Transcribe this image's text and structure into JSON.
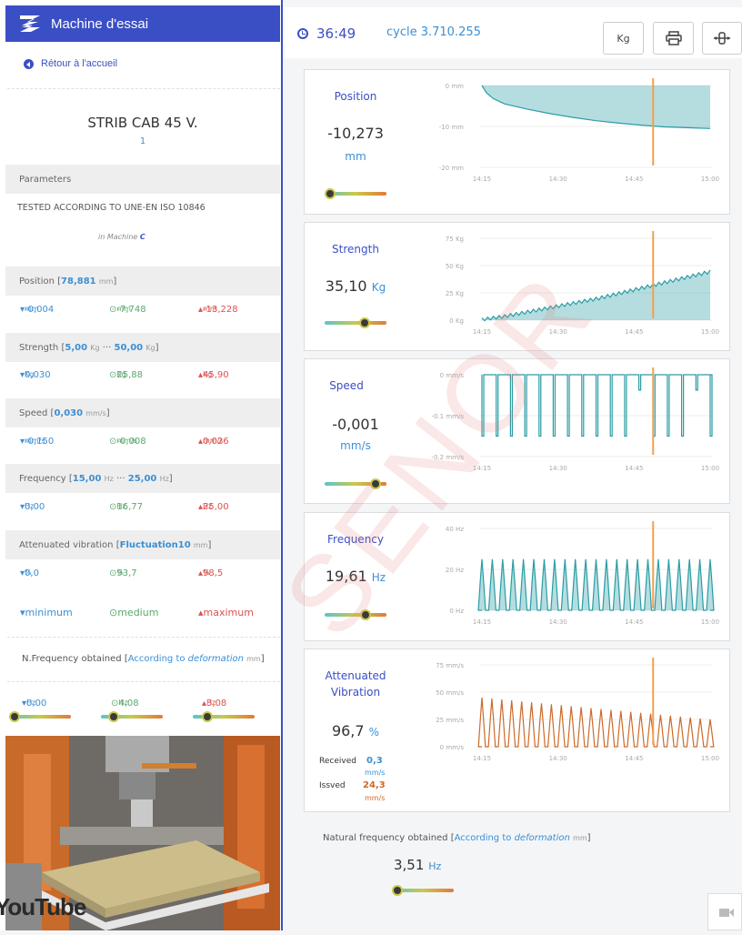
{
  "sidebar": {
    "title": "Machine d'essai",
    "back_label": "Rétour à l'accueil",
    "product_name": "STRIB CAB 45 V.",
    "product_sub": "1",
    "parameters_label": "Parameters",
    "tested_text": "TESTED ACCORDING TO UNE-EN ISO 10846",
    "machine_prefix": "in Machine",
    "machine_id": "C",
    "position": {
      "label": "Position",
      "range": "78,881",
      "range_unit": "mm",
      "min": "-0,004",
      "med": "-7,748",
      "max": "-13,228",
      "unit": "mm"
    },
    "strength": {
      "label": "Strength",
      "range_a": "5,00",
      "range_b": "50,00",
      "range_unit": "Kg",
      "sep": "···",
      "min": "0,030",
      "med": "25,88",
      "max": "45,90",
      "unit": "Kg"
    },
    "speed": {
      "label": "Speed",
      "range": "0,030",
      "range_unit": "mm/s",
      "min": "-0,150",
      "med": "-0,008",
      "max": "0,026",
      "unit": "mm/s"
    },
    "frequency": {
      "label": "Frequency",
      "range_a": "15,00",
      "range_b": "25,00",
      "range_unit": "Hz",
      "sep": "···",
      "min": "0,00",
      "med": "16,77",
      "max": "25,00",
      "unit": "Hz"
    },
    "attenuated": {
      "label": "Attenuated vibration",
      "range": "Fluctuation10",
      "range_unit": "mm",
      "min": "0,0",
      "med": "93,7",
      "max": "98,5",
      "unit": "%"
    },
    "legend": {
      "min": "minimum",
      "med": "medium",
      "max": "maximum"
    },
    "nfreq": {
      "label": "N.Frequency obtained",
      "note": "According to",
      "note_em": "deformation",
      "note_unit": "mm",
      "min": "0,00",
      "med": "4,08",
      "max": "3,08",
      "unit": "Hz"
    },
    "youtube": "YouTube"
  },
  "topbar": {
    "timer": "36:49",
    "cycle": "cycle 3.710.255",
    "unit_button": "Kg"
  },
  "panels": {
    "position": {
      "label": "Position",
      "value": "-10,273",
      "unit": "mm",
      "level": 0.0
    },
    "strength": {
      "label": "Strength",
      "value": "35,10",
      "unit": "Kg",
      "level": 0.67
    },
    "speed": {
      "label": "Speed",
      "value": "-0,001",
      "unit": "mm/s",
      "level": 0.9
    },
    "frequency": {
      "label": "Frequency",
      "value": "19,61",
      "unit": "Hz",
      "level": 0.7
    },
    "attenuated": {
      "label_1": "Attenuated",
      "label_2": "Vibration",
      "value": "96,7",
      "unit": "%",
      "received_label": "Received",
      "received_value": "0,3",
      "received_unit": "mm/s",
      "issued_label": "Issved",
      "issued_value": "24,3",
      "issued_unit": "mm/s"
    }
  },
  "natural": {
    "label": "Natural frequency obtained",
    "note": "According to",
    "note_em": "deformation",
    "note_unit": "mm",
    "value": "3,51",
    "unit": "Hz",
    "level": 0.0
  },
  "watermark": "SENOR",
  "chart_data": [
    {
      "type": "area",
      "series": [
        {
          "name": "Position",
          "color": "#2a9da5"
        }
      ],
      "ylabels": [
        "0 mm",
        "-10 mm",
        "-20 mm"
      ],
      "xlabels": [
        "14:15",
        "14:30",
        "14:45",
        "15:00"
      ],
      "ylim": [
        -20,
        0
      ],
      "x": [
        0,
        0.02,
        0.05,
        0.1,
        0.2,
        0.3,
        0.4,
        0.5,
        0.6,
        0.7,
        0.8,
        0.9,
        1.0
      ],
      "values": [
        0,
        -1.8,
        -3.2,
        -4.5,
        -5.8,
        -6.9,
        -7.8,
        -8.6,
        -9.2,
        -9.7,
        -10.1,
        -10.3,
        -10.5
      ]
    },
    {
      "type": "area",
      "series": [
        {
          "name": "Strength",
          "color": "#2a9da5"
        }
      ],
      "ylabels": [
        "75 Kg",
        "50 Kg",
        "25 Kg",
        "0 Kg"
      ],
      "xlabels": [
        "14:15",
        "14:30",
        "14:45",
        "15:00"
      ],
      "ylim": [
        0,
        75
      ],
      "x": [
        0,
        0.1,
        0.2,
        0.3,
        0.4,
        0.5,
        0.6,
        0.7,
        0.8,
        0.9,
        1.0
      ],
      "values": [
        2,
        5,
        9,
        13,
        17,
        21,
        26,
        31,
        36,
        41,
        46
      ]
    },
    {
      "type": "line",
      "series": [
        {
          "name": "Speed",
          "color": "#2a9da5"
        }
      ],
      "ylabels": [
        "0 mm/s",
        "-0.1 mm/s",
        "-0.2 mm/s"
      ],
      "xlabels": [
        "14:15",
        "14:30",
        "14:45",
        "15:00"
      ],
      "ylim": [
        -0.2,
        0
      ],
      "pulses": 17,
      "pulse_depth": -0.15
    },
    {
      "type": "area",
      "series": [
        {
          "name": "Frequency",
          "color": "#2a9da5"
        }
      ],
      "ylabels": [
        "40 Hz",
        "20 Hz",
        "0 Hz"
      ],
      "xlabels": [
        "14:15",
        "14:30",
        "14:45",
        "15:00"
      ],
      "ylim": [
        0,
        40
      ],
      "peaks": 23,
      "peak_value": 25
    },
    {
      "type": "line",
      "series": [
        {
          "name": "Attenuated Vibration",
          "color": "#cc6a2b"
        }
      ],
      "ylabels": [
        "75 mm/s",
        "50 mm/s",
        "25 mm/s",
        "0 mm/s"
      ],
      "xlabels": [
        "14:15",
        "14:30",
        "14:45",
        "15:00"
      ],
      "ylim": [
        0,
        75
      ],
      "peaks": 24,
      "peak_start": 45,
      "peak_end": 25
    }
  ]
}
